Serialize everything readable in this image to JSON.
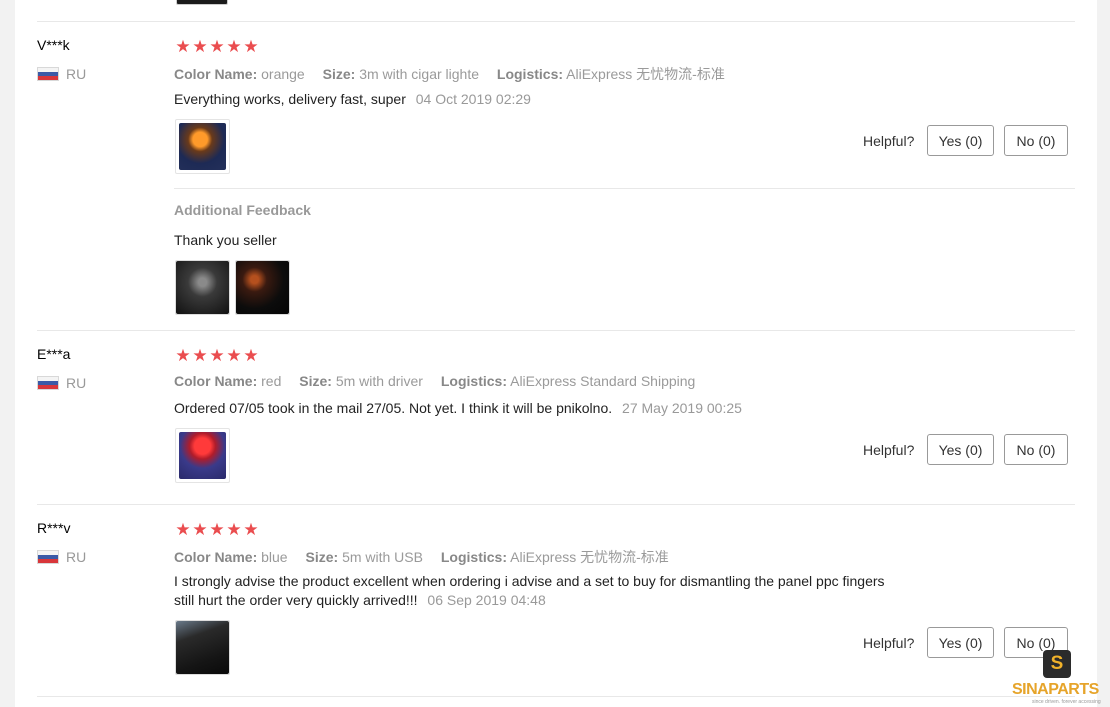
{
  "helpful_label": "Helpful?",
  "additional_feedback_title": "Additional Feedback",
  "attr_labels": {
    "color": "Color Name:",
    "size": "Size:",
    "logistics": "Logistics:"
  },
  "reviews": [
    {
      "user": "V***k",
      "country": "RU",
      "rating": 5,
      "color": "orange",
      "size": "3m with cigar lighte",
      "logistics": "AliExpress 无忧物流-标准",
      "text": "Everything works, delivery fast, super",
      "date": "04 Oct 2019 02:29",
      "yes": "Yes (0)",
      "no": "No (0)",
      "additional_feedback": "Thank you seller"
    },
    {
      "user": "E***a",
      "country": "RU",
      "rating": 5,
      "color": "red",
      "size": "5m with driver",
      "logistics": "AliExpress Standard Shipping",
      "text": "Ordered 07/05 took in the mail 27/05. Not yet. I think it will be pnikolno.",
      "date": "27 May 2019 00:25",
      "yes": "Yes (0)",
      "no": "No (0)"
    },
    {
      "user": "R***v",
      "country": "RU",
      "rating": 5,
      "color": "blue",
      "size": "5m with USB",
      "logistics": "AliExpress 无忧物流-标准",
      "text_line1": "I strongly advise the product excellent when ordering i advise and a set to buy for dismantling the panel ppc fingers",
      "text_line2": "still hurt the order very quickly arrived!!!",
      "date": "06 Sep 2019 04:48",
      "yes": "Yes (0)",
      "no": "No (0)"
    }
  ],
  "watermark": {
    "badge": "S",
    "brand": "SINAPARTS",
    "tagline": "since driven. forever accessing"
  },
  "colors": {
    "star": "#ea4d4f",
    "muted": "#999999",
    "divider": "#e8e8e8"
  }
}
